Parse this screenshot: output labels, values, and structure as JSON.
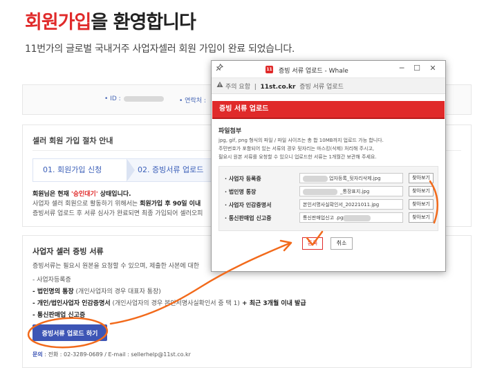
{
  "page": {
    "headline_red": "회원가입",
    "headline_dark": "을 환영합니다",
    "subline": "11번가의 글로벌 국내거주 사업자셀러 회원 가입이 완료 되었습니다.",
    "id_label": "• ID :",
    "contact_label": "• 연락처 :"
  },
  "process": {
    "title": "셀러 회원 가입 절차 안내",
    "step1": "01. 회원가입 신청",
    "step2": "02. 증빙서류 업로드",
    "status_prefix": "회원님은 현재 ",
    "status_value": "'승인대기'",
    "status_suffix": " 상태입니다.",
    "desc1_a": "사업자 셀러 회원으로 활동하기 위해서는 ",
    "desc1_b": "회원가입 후 90일 이내",
    "desc2": "증빙서류 업로드 후 서류 심사가 완료되면 최종 가입되어 셀러오피"
  },
  "docs": {
    "title": "사업자 셀러 증빙 서류",
    "intro": "증빙서류는 필요시 원본을 요청할 수 있으며, 제출한 사본에 대한",
    "item1": "- 사업자등록증",
    "item2_b": "- 법인명의 통장",
    "item2_n": " (개인사업자의 경우 대표자 통장)",
    "item3_b": "- 개인/법인사업자 인감증명서",
    "item3_n": " (개인사업자의 경우 본인서명사실확인서 중 택 1)",
    "item3_tail": " + 최근 3개월 이내 발급",
    "item4": "- 통신판매업 신고증",
    "upload_button": "증빙서류 업로드 하기",
    "contact_label": "문의",
    "contact_text": " : 전화 : 02-3289-0689 / E-mail : sellerhelp@11st.co.kr"
  },
  "popup": {
    "app_icon": "11",
    "window_title": "증빙 서류 업로드 - Whale",
    "minimize": "─",
    "maximize": "☐",
    "close": "✕",
    "warning_label": "주의 요함",
    "separator": "|",
    "url_domain": "11st.co.kr",
    "url_title": "증빙 서류 업로드",
    "header": "증빙 서류 업로드",
    "attach_title": "파일첨부",
    "note1": "jpg, gif, png 형식의 파일 / 파일 사이즈는 총 합 10MB까지 업로드 가능 합니다.",
    "note2": "주민번호가 포함되어 있는 서류의 경우 뒷자리는 마스킹(삭제) 처리해 주시고,",
    "note3": "필요시 원본 서류를 요청할 수 있으니 업로드한 서류는 1개월간 보관해 주세요.",
    "rows": [
      {
        "label": "· 사업자 등록증",
        "file": "업자등록_뒷자리삭제.jpg",
        "button": "찾아보기"
      },
      {
        "label": "· 법인명 통장",
        "file": "_통장표지.jpg",
        "button": "찾아보기"
      },
      {
        "label": "· 사업자 인감증명서",
        "file": "본인서명사실확인서_20221011.jpg",
        "button": "찾아보기"
      },
      {
        "label": "· 통신판매업 신고증",
        "file": "통신판매업신고          .pg",
        "button": "찾아보기"
      }
    ],
    "register_button": "등록",
    "cancel_button": "취소"
  },
  "colors": {
    "brand_red": "#e02a2a",
    "annotation_orange": "#f26a1b",
    "upload_blue": "#3d55b5"
  },
  "icons": {
    "pin": "pin-icon",
    "warning": "warning-icon",
    "app": "whale-app-icon"
  }
}
